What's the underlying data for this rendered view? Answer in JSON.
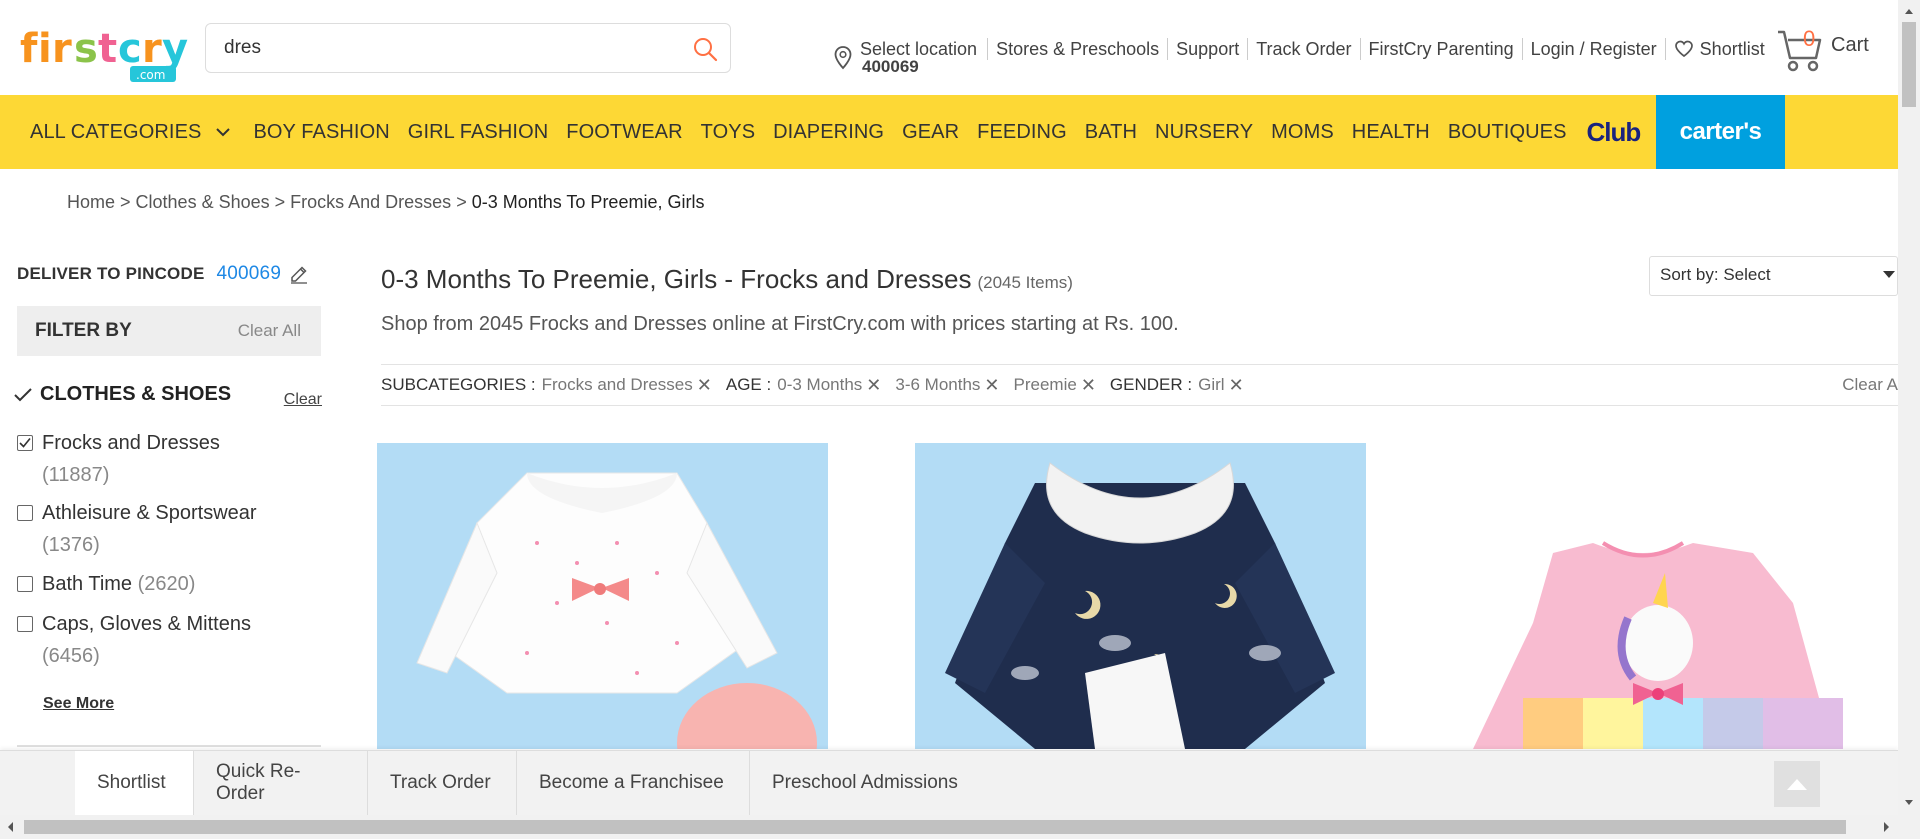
{
  "search": {
    "value": "dres"
  },
  "header": {
    "location_label": "Select location",
    "location_pincode": "400069",
    "links": [
      "Stores & Preschools",
      "Support",
      "Track Order",
      "FirstCry Parenting",
      "Login / Register"
    ],
    "shortlist": "Shortlist",
    "cart_count": "0",
    "cart_label": "Cart"
  },
  "categories": {
    "all": "ALL CATEGORIES",
    "items": [
      "BOY FASHION",
      "GIRL FASHION",
      "FOOTWEAR",
      "TOYS",
      "DIAPERING",
      "GEAR",
      "FEEDING",
      "BATH",
      "NURSERY",
      "MOMS",
      "HEALTH",
      "BOUTIQUES"
    ],
    "club": "Club",
    "carters": "carter's"
  },
  "breadcrumb": {
    "items": [
      "Home",
      "Clothes & Shoes",
      "Frocks And Dresses"
    ],
    "current": "0-3 Months To Preemie, Girls"
  },
  "sidebar": {
    "deliver_label": "DELIVER TO PINCODE",
    "pincode": "400069",
    "filter_by": "FILTER BY",
    "clear_all": "Clear All",
    "section_title": "CLOTHES & SHOES",
    "section_clear": "Clear",
    "items": [
      {
        "label": "Frocks and Dresses",
        "count": "(11887)",
        "checked": true
      },
      {
        "label": "Athleisure & Sportswear",
        "count": "(1376)",
        "checked": false
      },
      {
        "label": "Bath Time",
        "count": "(2620)",
        "checked": false
      },
      {
        "label": "Caps, Gloves & Mittens",
        "count": "(6456)",
        "checked": false
      }
    ],
    "see_more": "See More"
  },
  "main": {
    "title": "0-3 Months To Preemie, Girls - Frocks and Dresses",
    "count": "(2045 Items)",
    "subtitle": "Shop from 2045 Frocks and Dresses online at FirstCry.com with prices starting at Rs. 100.",
    "sort_label": "Sort by:",
    "sort_value": "Select",
    "chips": {
      "subcategories_label": "SUBCATEGORIES :",
      "subcategory": "Frocks and Dresses",
      "age_label": "AGE :",
      "ages": [
        "0-3 Months",
        "3-6 Months",
        "Preemie"
      ],
      "gender_label": "GENDER :",
      "gender": "Girl",
      "clear": "Clear A"
    }
  },
  "bottom_bar": {
    "items": [
      "Shortlist",
      "Quick Re-Order",
      "Track Order",
      "Become a Franchisee",
      "Preschool Admissions"
    ]
  },
  "colors": {
    "brand_yellow": "#fdd835",
    "carters_blue": "#00a0df",
    "link_blue": "#1e88e5",
    "cart_orange": "#ff7043"
  }
}
